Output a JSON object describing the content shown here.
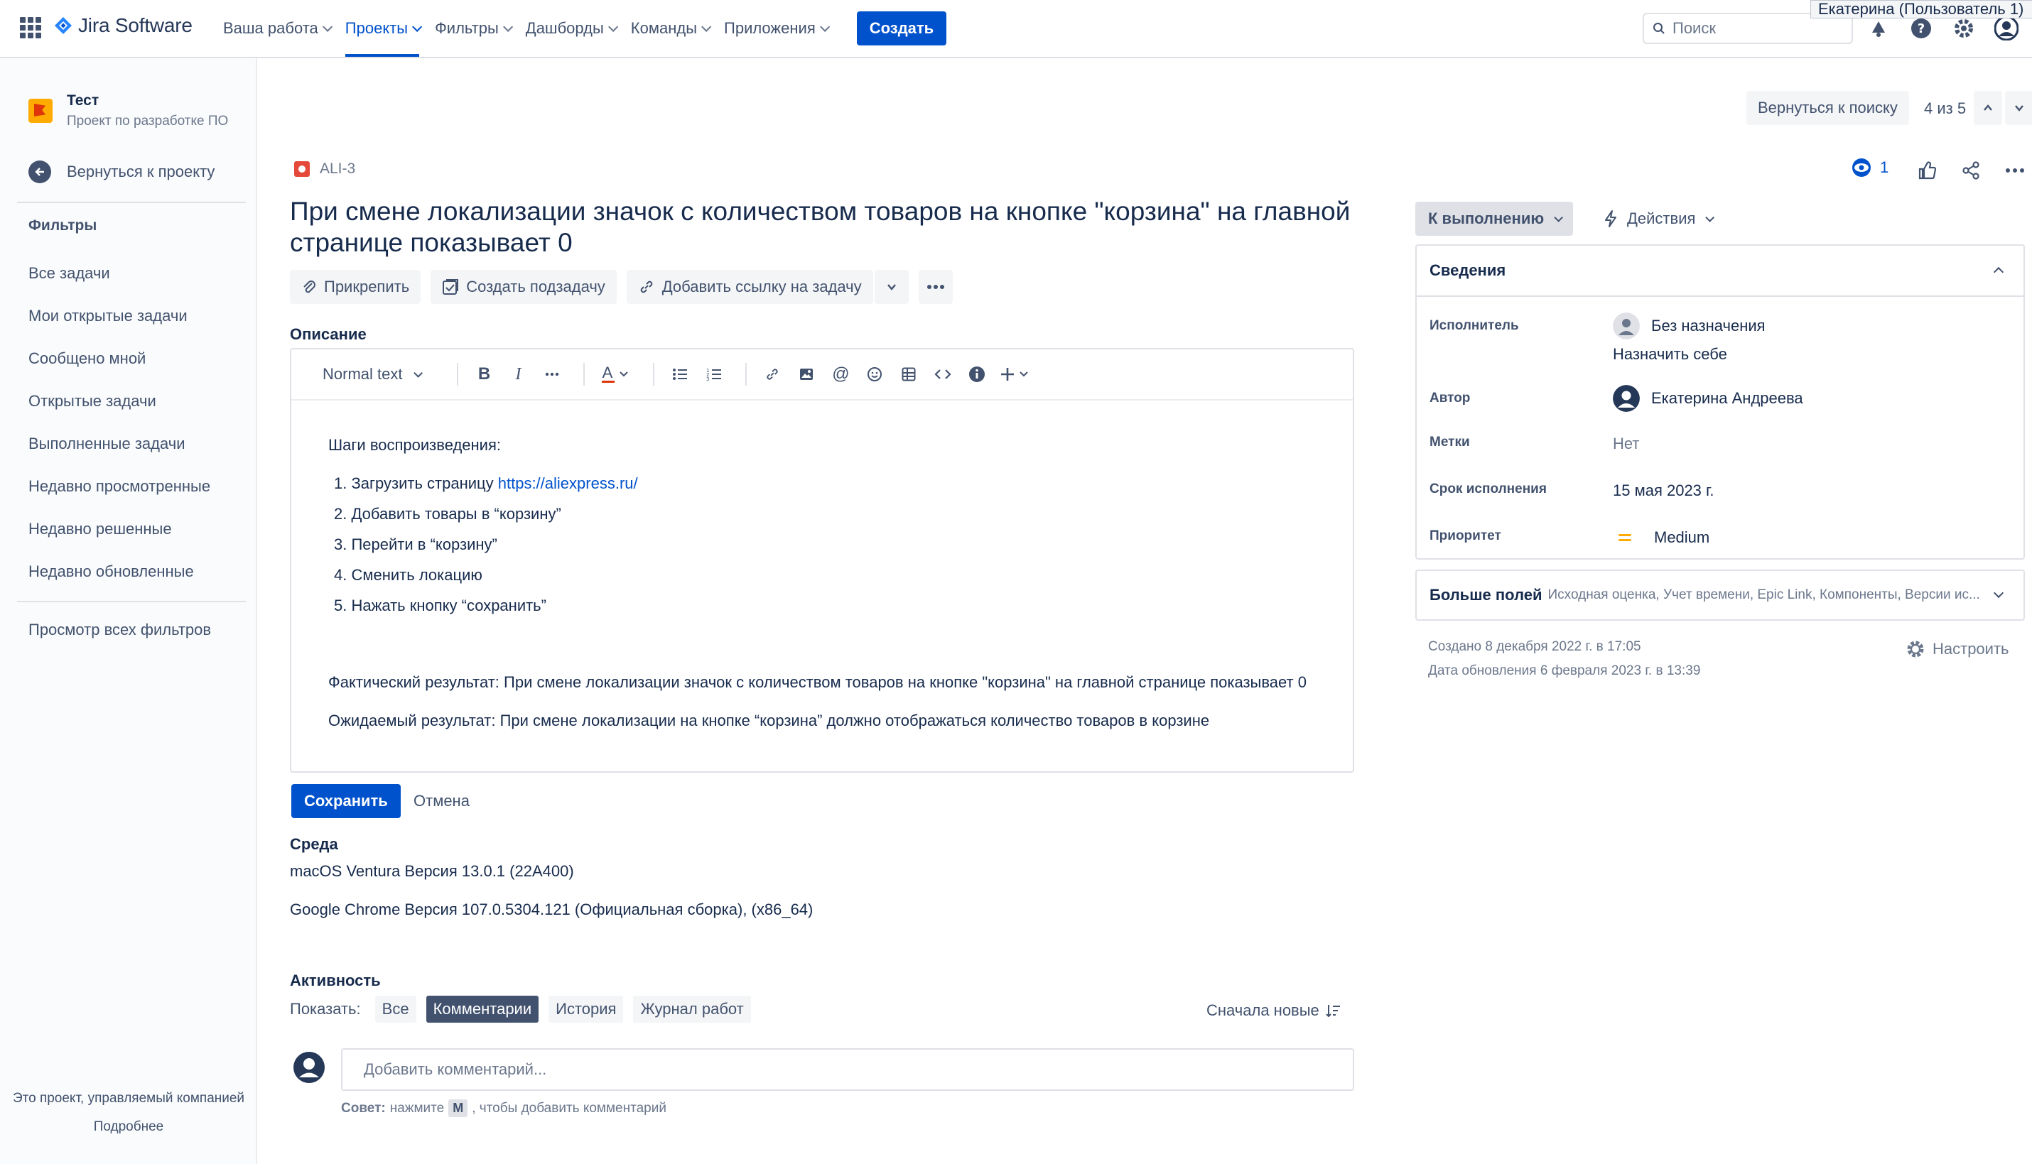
{
  "topbar": {
    "logo_text": "Jira Software",
    "nav": [
      {
        "label": "Ваша работа"
      },
      {
        "label": "Проекты"
      },
      {
        "label": "Фильтры"
      },
      {
        "label": "Дашборды"
      },
      {
        "label": "Команды"
      },
      {
        "label": "Приложения"
      }
    ],
    "create_label": "Создать",
    "search_placeholder": "Поиск",
    "tooltip_text": "Екатерина (Пользователь 1)",
    "icons": [
      "notifications-icon",
      "help-icon",
      "settings-icon",
      "profile-icon"
    ]
  },
  "sidebar": {
    "project_name": "Тест",
    "project_type": "Проект по разработке ПО",
    "back_label": "Вернуться к проекту",
    "filters_heading": "Фильтры",
    "filters": [
      "Все задачи",
      "Мои открытые задачи",
      "Сообщено мной",
      "Открытые задачи",
      "Выполненные задачи",
      "Недавно просмотренные",
      "Недавно решенные",
      "Недавно обновленные"
    ],
    "all_filters_label": "Просмотр всех фильтров",
    "footer_text": "Это проект, управляемый компанией",
    "footer_link": "Подробнее"
  },
  "nav_controls": {
    "back_to_search": "Вернуться к поиску",
    "pager": "4 из 5"
  },
  "issue": {
    "key": "ALI-3",
    "title": "При смене локализации значок с количеством товаров на кнопке \"корзина\" на главной странице показывает 0",
    "actions": {
      "attach": "Прикрепить",
      "subtask": "Создать подзадачу",
      "link": "Добавить ссылку на задачу"
    },
    "description_label": "Описание",
    "editor": {
      "text_style": "Normal text",
      "steps_heading": "Шаги воспроизведения:",
      "steps": [
        {
          "num": "1.",
          "text": "Загрузить страницу ",
          "link": "https://aliexpress.ru/"
        },
        {
          "num": "2.",
          "text": "Добавить товары в “корзину”"
        },
        {
          "num": "3.",
          "text": "Перейти в “корзину”"
        },
        {
          "num": "4.",
          "text": "Сменить локацию"
        },
        {
          "num": "5.",
          "text": "Нажать кнопку “сохранить”"
        }
      ],
      "actual": "Фактический результат: При смене локализации значок с количеством товаров на кнопке \"корзина\" на главной странице показывает 0",
      "expected": "Ожидаемый результат: При смене локализации на кнопке “корзина” должно отображаться количество товаров в корзине"
    },
    "save_label": "Сохранить",
    "cancel_label": "Отмена",
    "environment_label": "Среда",
    "environment": [
      "macOS Ventura Версия 13.0.1 (22A400)",
      "Google Chrome Версия 107.0.5304.121 (Официальная сборка), (x86_64)"
    ],
    "activity": {
      "label": "Активность",
      "show_label": "Показать:",
      "filters": [
        "Все",
        "Комментарии",
        "История",
        "Журнал работ"
      ],
      "selected": "Комментарии",
      "sort_label": "Сначала новые",
      "comment_placeholder": "Добавить комментарий...",
      "tip_bold": "Совет:",
      "tip_before": "нажмите",
      "tip_key": "M",
      "tip_after": ", чтобы добавить комментарий"
    }
  },
  "right_panel": {
    "watchers": "1",
    "status": "К выполнению",
    "actions_label": "Действия",
    "details_heading": "Сведения",
    "fields": {
      "assignee_key": "Исполнитель",
      "assignee_val": "Без назначения",
      "assign_self": "Назначить себе",
      "reporter_key": "Автор",
      "reporter_val": "Екатерина Андреева",
      "labels_key": "Метки",
      "labels_val": "Нет",
      "due_key": "Срок исполнения",
      "due_val": "15 мая 2023 г.",
      "priority_key": "Приоритет",
      "priority_val": "Medium"
    },
    "more_fields_title": "Больше полей",
    "more_fields_list": "Исходная оценка, Учет времени, Epic Link, Компоненты, Версии ис...",
    "created": "Создано 8 декабря 2022 г. в 17:05",
    "updated": "Дата обновления 6 февраля 2023 г. в 13:39",
    "configure_label": "Настроить"
  },
  "colors": {
    "brand_blue": "#0052cc",
    "text_dark": "#172b4d",
    "text_muted": "#6b778c",
    "bug_red": "#e5493a",
    "priority_medium": "#ffab00"
  }
}
